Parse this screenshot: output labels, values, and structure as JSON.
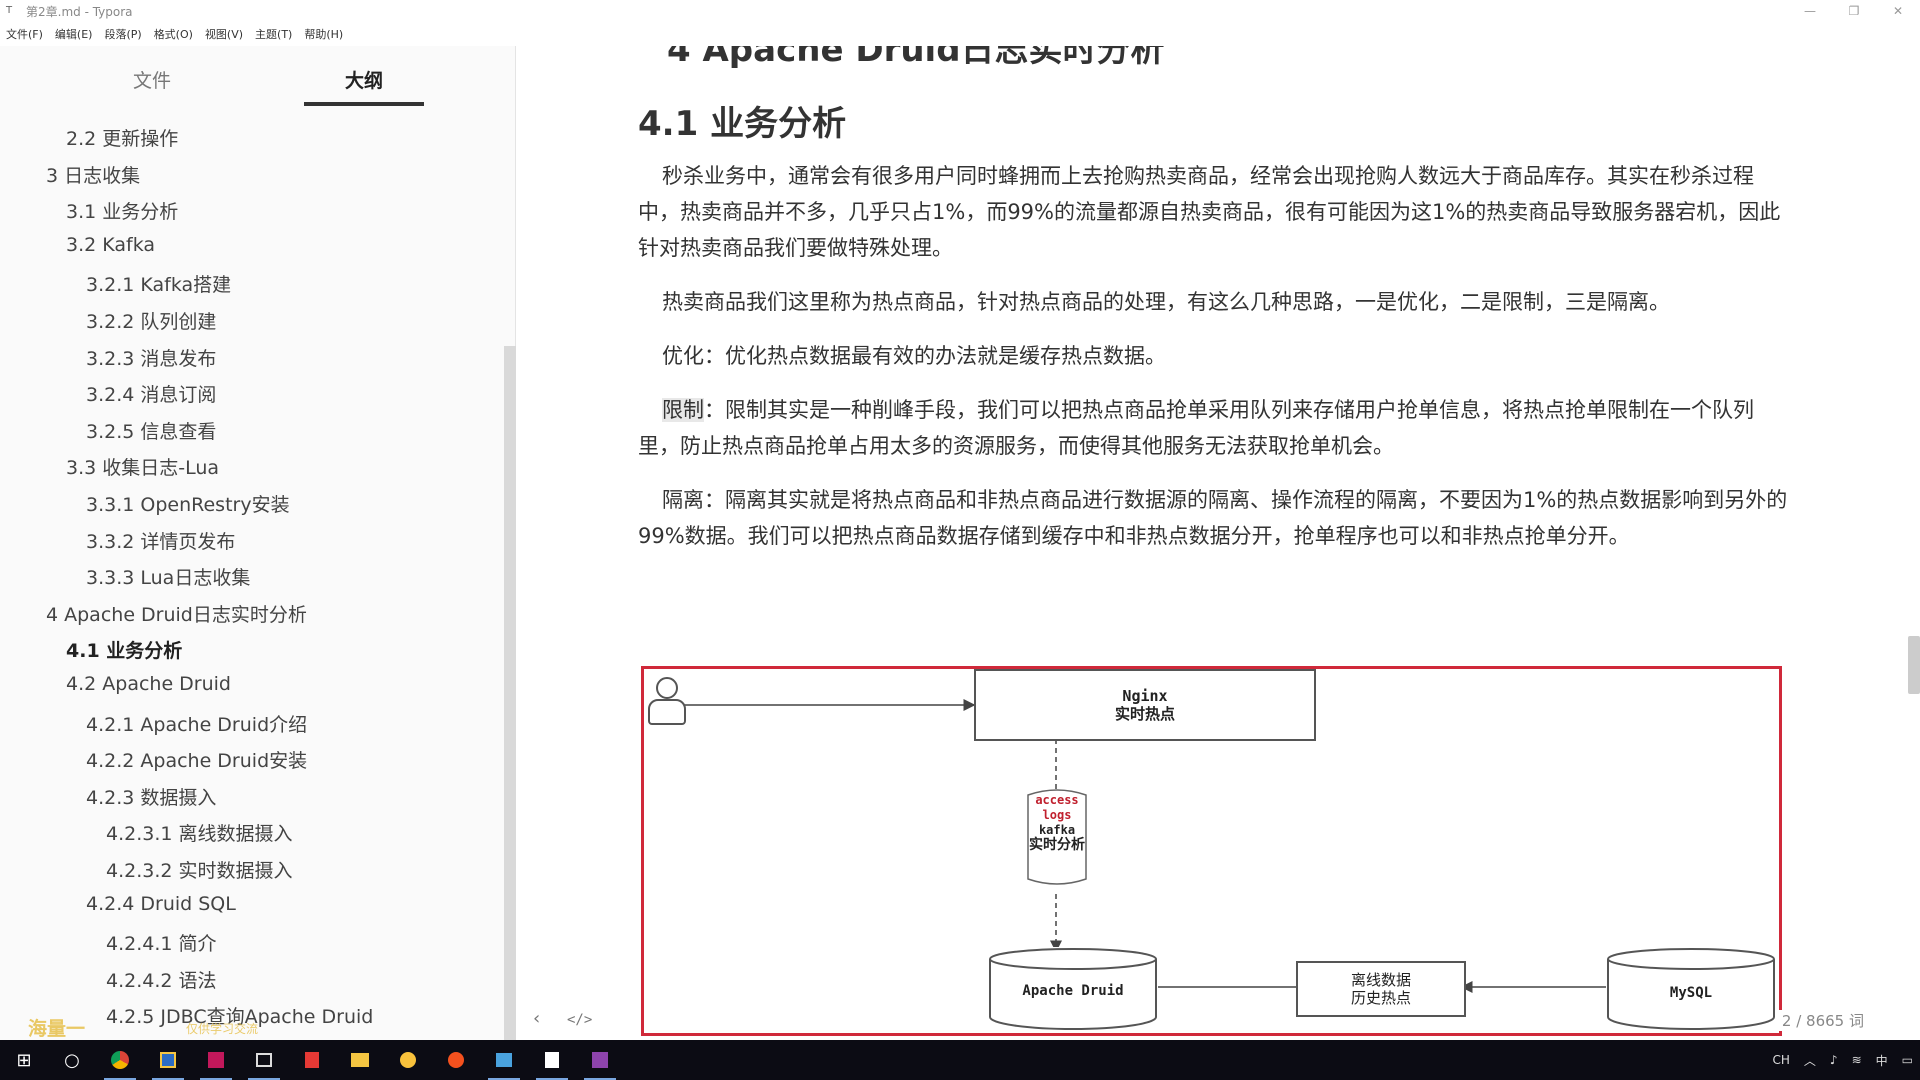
{
  "window": {
    "title": "第2章.md - Typora"
  },
  "menu": [
    "文件(F)",
    "编辑(E)",
    "段落(P)",
    "格式(O)",
    "视图(V)",
    "主题(T)",
    "帮助(H)"
  ],
  "sidebar": {
    "tabs": [
      "文件",
      "大纲"
    ],
    "active_tab": "大纲",
    "outline": [
      {
        "label": "2.2 更新操作",
        "level": 2
      },
      {
        "label": "3 日志收集",
        "level": 1
      },
      {
        "label": "3.1 业务分析",
        "level": 2
      },
      {
        "label": "3.2 Kafka",
        "level": 2
      },
      {
        "label": "3.2.1 Kafka搭建",
        "level": 3
      },
      {
        "label": "3.2.2 队列创建",
        "level": 3
      },
      {
        "label": "3.2.3 消息发布",
        "level": 3
      },
      {
        "label": "3.2.4 消息订阅",
        "level": 3
      },
      {
        "label": "3.2.5 信息查看",
        "level": 3
      },
      {
        "label": "3.3 收集日志-Lua",
        "level": 2
      },
      {
        "label": "3.3.1 OpenRestry安装",
        "level": 3
      },
      {
        "label": "3.3.2 详情页发布",
        "level": 3
      },
      {
        "label": "3.3.3 Lua日志收集",
        "level": 3
      },
      {
        "label": "4 Apache Druid日志实时分析",
        "level": 1
      },
      {
        "label": "4.1 业务分析",
        "level": 2,
        "active": true
      },
      {
        "label": "4.2 Apache Druid",
        "level": 2
      },
      {
        "label": "4.2.1 Apache Druid介绍",
        "level": 3
      },
      {
        "label": "4.2.2 Apache Druid安装",
        "level": 3
      },
      {
        "label": "4.2.3 数据摄入",
        "level": 3
      },
      {
        "label": "4.2.3.1 离线数据摄入",
        "level": 4
      },
      {
        "label": "4.2.3.2 实时数据摄入",
        "level": 4
      },
      {
        "label": "4.2.4 Druid SQL",
        "level": 3
      },
      {
        "label": "4.2.4.1 简介",
        "level": 4
      },
      {
        "label": "4.2.4.2 语法",
        "level": 4
      },
      {
        "label": "4.2.5 JDBC查询Apache Druid",
        "level": 4
      }
    ],
    "watermark": "海量一",
    "watermark_small": "仅供学习交流"
  },
  "editor": {
    "cut_heading": "4 Apache Druid日志实时分析",
    "heading": "4.1 业务分析",
    "paragraphs": [
      {
        "text": "秒杀业务中，通常会有很多用户同时蜂拥而上去抢购热卖商品，经常会出现抢购人数远大于商品库存。其实在秒杀过程中，热卖商品并不多，几乎只占1%，而99%的流量都源自热卖商品，很有可能因为这1%的热卖商品导致服务器宕机，因此针对热卖商品我们要做特殊处理。"
      },
      {
        "text": "热卖商品我们这里称为热点商品，针对热点商品的处理，有这么几种思路，一是优化，二是限制，三是隔离。"
      },
      {
        "text": "优化：优化热点数据最有效的办法就是缓存热点数据。"
      },
      {
        "prefix": "限制",
        "text": "：限制其实是一种削峰手段，我们可以把热点商品抢单采用队列来存储用户抢单信息，将热点抢单限制在一个队列里，防止热点商品抢单占用太多的资源服务，而使得其他服务无法获取抢单机会。"
      },
      {
        "text": "隔离：隔离其实就是将热点商品和非热点商品进行数据源的隔离、操作流程的隔离，不要因为1%的热点数据影响到另外的99%数据。我们可以把热点商品数据存储到缓存中和非热点数据分开，抢单程序也可以和非热点抢单分开。"
      }
    ],
    "diagram": {
      "nginx_label_1": "Nginx",
      "nginx_label_2": "实时热点",
      "kafka_label_1": "access",
      "kafka_label_2": "logs",
      "kafka_label_3": "kafka",
      "kafka_label_4": "实时分析",
      "druid_label": "Apache Druid",
      "offline_label_1": "离线数据",
      "offline_label_2": "历史热点",
      "mysql_label": "MySQL",
      "border_color": "#d0293a"
    },
    "word_count": "2 / 8665 词",
    "footer_icons": [
      "chevron-left-icon",
      "code-icon"
    ]
  },
  "taskbar": {
    "tray": [
      "CH",
      "中"
    ]
  }
}
